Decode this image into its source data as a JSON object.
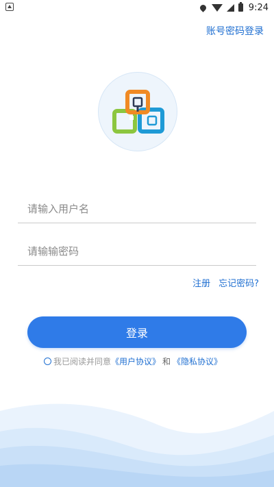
{
  "status_bar": {
    "time": "9:24",
    "icons": [
      "app-notification-icon",
      "location-icon",
      "wifi-icon",
      "signal-icon",
      "battery-icon"
    ]
  },
  "header": {
    "account_login_link": "账号密码登录"
  },
  "form": {
    "username_placeholder": "请输入用户名",
    "password_placeholder": "请输输密码",
    "register_link": "注册",
    "forgot_password_link": "忘记密码?",
    "login_button": "登录"
  },
  "agreement": {
    "prefix": "我已阅读并同意",
    "user_agreement": "《用户协议》",
    "conjunction": "和",
    "privacy_agreement": "《隐私协议》"
  },
  "colors": {
    "accent": "#2f7be8",
    "link": "#1f6fd1",
    "logo_orange": "#f08a24",
    "logo_green": "#8cc63f",
    "logo_blue": "#1e9ad6"
  }
}
